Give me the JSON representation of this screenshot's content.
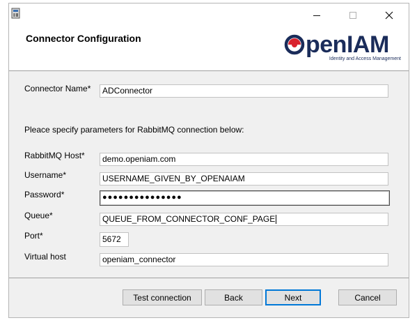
{
  "window": {
    "header_title": "Connector Configuration"
  },
  "logo": {
    "brand": "penIAM",
    "tagline": "Identity and Access Management"
  },
  "form": {
    "connector_name_label": "Connector Name*",
    "connector_name_value": "ADConnector",
    "instructions": "Pleace specify parameters for RabbitMQ connection below:",
    "host_label": "RabbitMQ Host*",
    "host_value": "demo.openiam.com",
    "username_label": "Username*",
    "username_value": "USERNAME_GIVEN_BY_OPENAIAM",
    "password_label": "Password*",
    "password_value": "●●●●●●●●●●●●●●●",
    "queue_label": "Queue*",
    "queue_value": "QUEUE_FROM_CONNECTOR_CONF_PAGE",
    "port_label": "Port*",
    "port_value": "5672",
    "vhost_label": "Virtual host",
    "vhost_value": "openiam_connector"
  },
  "buttons": {
    "test": "Test connection",
    "back": "Back",
    "next": "Next",
    "cancel": "Cancel"
  },
  "colors": {
    "accent": "#0078d7",
    "brand_navy": "#1a2c5a",
    "brand_red": "#d9232e",
    "panel_gray": "#f0f0f0"
  }
}
